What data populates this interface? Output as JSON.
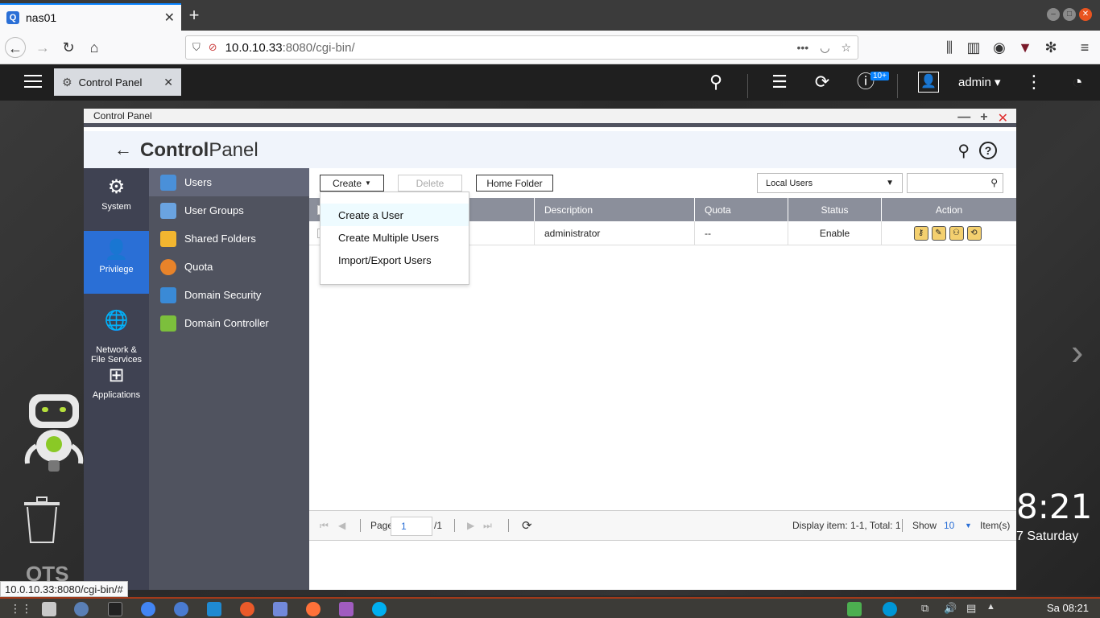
{
  "browser": {
    "tab_title": "nas01",
    "tab_favicon": "Q",
    "url_host": "10.0.10.33",
    "url_rest": ":8080/cgi-bin/",
    "status_url": "10.0.10.33:8080/cgi-bin/#"
  },
  "qts": {
    "app_tab_title": "Control Panel",
    "notification_badge": "10+",
    "user_label": "admin ▾",
    "clock_time": "8:21",
    "clock_date": "7 Saturday",
    "logo_text": "QTS"
  },
  "window": {
    "titlebar": "Control Panel",
    "title_bold": "Control",
    "title_light": "Panel"
  },
  "categories": [
    {
      "label": "System"
    },
    {
      "label": "Privilege"
    },
    {
      "label": "Network &\nFile Services"
    },
    {
      "label": "Applications"
    }
  ],
  "submenu": [
    {
      "label": "Users"
    },
    {
      "label": "User Groups"
    },
    {
      "label": "Shared Folders"
    },
    {
      "label": "Quota"
    },
    {
      "label": "Domain Security"
    },
    {
      "label": "Domain Controller"
    }
  ],
  "toolbar": {
    "create_label": "Create",
    "delete_label": "Delete",
    "home_folder_label": "Home Folder",
    "filter_value": "Local Users"
  },
  "grid": {
    "headers": {
      "description": "Description",
      "quota": "Quota",
      "status": "Status",
      "action": "Action"
    },
    "rows": [
      {
        "description": "administrator",
        "quota": "--",
        "status": "Enable"
      }
    ]
  },
  "dropdown": {
    "items": [
      "Create a User",
      "Create Multiple Users",
      "Import/Export Users"
    ]
  },
  "pager": {
    "page_label": "Page",
    "page_value": "1",
    "page_total": "/1",
    "display_info": "Display item: 1-1, Total: 1",
    "show_label": "Show",
    "show_value": "10",
    "items_label": "Item(s)"
  },
  "taskbar": {
    "clock": "Sa 08:21"
  },
  "colors": {
    "accent": "#2a6fd6",
    "sidebar_dark": "#3f4252",
    "sidebar_sub": "#50535f",
    "grid_header": "#8b8f9b"
  }
}
